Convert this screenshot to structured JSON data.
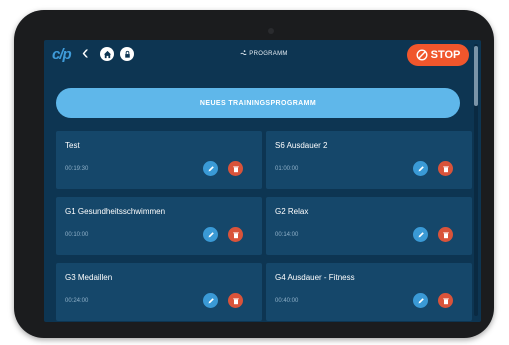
{
  "header": {
    "logo": "c/p",
    "title": "PROGRAMM",
    "stop_label": "STOP"
  },
  "new_program_button": "NEUES TRAININGSPROGRAMM",
  "programs": [
    {
      "name": "Test",
      "duration": "00:19:30"
    },
    {
      "name": "S6 Ausdauer 2",
      "duration": "01:00:00"
    },
    {
      "name": "G1 Gesundheitsschwimmen",
      "duration": "00:10:00"
    },
    {
      "name": "G2 Relax",
      "duration": "00:14:00"
    },
    {
      "name": "G3 Medaillen",
      "duration": "00:24:00"
    },
    {
      "name": "G4 Ausdauer - Fitness",
      "duration": "00:40:00"
    }
  ],
  "icons": {
    "back": "chevron-left-icon",
    "home": "home-icon",
    "lock": "lock-icon",
    "program": "swim-icon",
    "stop": "stop-icon",
    "edit": "pencil-icon",
    "delete": "trash-icon"
  },
  "colors": {
    "background": "#0d3552",
    "card": "#15476a",
    "accent": "#5fb7ea",
    "stop": "#f0562c",
    "delete": "#d9533a"
  }
}
